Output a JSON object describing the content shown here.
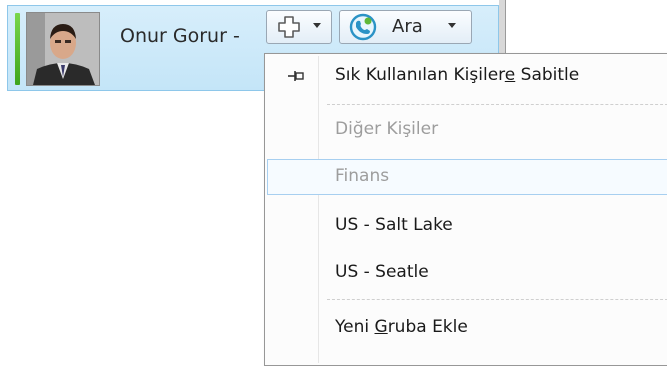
{
  "contact": {
    "name": "Onur Gorur -",
    "presence_color": "#4cb526"
  },
  "toolbar": {
    "add_icon": "add-contact-icon",
    "call_icon": "phone-call-icon",
    "call_label": "Ara"
  },
  "menu": {
    "pin_item": {
      "label_start": "Sık Kullanılan Kişiler",
      "label_accel": "e",
      "label_end": " Sabitle",
      "icon": "pin-icon"
    },
    "other_contacts": "Diğer Kişiler",
    "finance": "Finans",
    "salt_lake": "US - Salt Lake",
    "seattle": "US - Seatle",
    "new_group": {
      "label_start": "Yeni ",
      "label_accel": "G",
      "label_end": "ruba Ekle"
    }
  }
}
